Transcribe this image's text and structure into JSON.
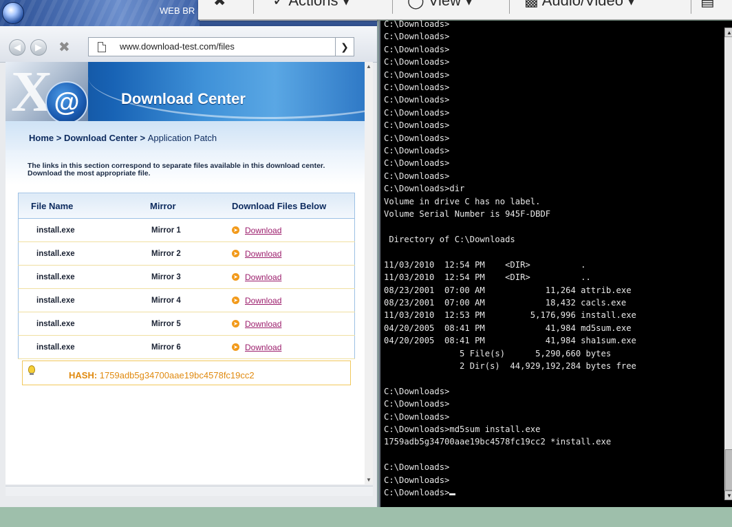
{
  "browser": {
    "title": "WEB BR",
    "address": "www.download-test.com/files",
    "back_icon": "back-arrow-icon",
    "forward_icon": "forward-arrow-icon",
    "stop_icon": "close-icon",
    "go_icon": "chevron-right-icon"
  },
  "page": {
    "banner_title": "Download Center",
    "breadcrumb": {
      "home": "Home",
      "sep1": " > ",
      "section": "Download Center",
      "sep2": " > ",
      "current": "Application Patch"
    },
    "intro": "The links in this section correspond to separate files available in this download center. Download the most appropriate file.",
    "table": {
      "headers": [
        "File Name",
        "Mirror",
        "Download Files Below"
      ],
      "rows": [
        {
          "file": "install.exe",
          "mirror": "Mirror 1",
          "link": "Download"
        },
        {
          "file": "install.exe",
          "mirror": "Mirror 2",
          "link": "Download"
        },
        {
          "file": "install.exe",
          "mirror": "Mirror 3",
          "link": "Download"
        },
        {
          "file": "install.exe",
          "mirror": "Mirror 4",
          "link": "Download"
        },
        {
          "file": "install.exe",
          "mirror": "Mirror 5",
          "link": "Download"
        },
        {
          "file": "install.exe",
          "mirror": "Mirror 6",
          "link": "Download"
        }
      ]
    },
    "hash_label": "HASH:",
    "hash_value": "1759adb5g34700aae19bc4578fc19cc2"
  },
  "overlay_toolbar": {
    "items": [
      "Actions",
      "View",
      "Audio/Video"
    ]
  },
  "terminal": {
    "lines": [
      "C:\\Downloads>",
      "C:\\Downloads>",
      "C:\\Downloads>",
      "C:\\Downloads>",
      "C:\\Downloads>",
      "C:\\Downloads>",
      "C:\\Downloads>",
      "C:\\Downloads>",
      "C:\\Downloads>",
      "C:\\Downloads>",
      "C:\\Downloads>",
      "C:\\Downloads>",
      "C:\\Downloads>",
      "C:\\Downloads>dir",
      "Volume in drive C has no label.",
      "Volume Serial Number is 945F-DBDF",
      "",
      " Directory of C:\\Downloads",
      "",
      "11/03/2010  12:54 PM    <DIR>          .",
      "11/03/2010  12:54 PM    <DIR>          ..",
      "08/23/2001  07:00 AM            11,264 attrib.exe",
      "08/23/2001  07:00 AM            18,432 cacls.exe",
      "11/03/2010  12:53 PM         5,176,996 install.exe",
      "04/20/2005  08:41 PM            41,984 md5sum.exe",
      "04/20/2005  08:41 PM            41,984 sha1sum.exe",
      "               5 File(s)      5,290,660 bytes",
      "               2 Dir(s)  44,929,192,284 bytes free",
      "",
      "C:\\Downloads>",
      "C:\\Downloads>",
      "C:\\Downloads>",
      "C:\\Downloads>md5sum install.exe",
      "1759adb5g34700aae19bc4578fc19cc2 *install.exe",
      "",
      "C:\\Downloads>",
      "C:\\Downloads>",
      "C:\\Downloads>"
    ]
  }
}
